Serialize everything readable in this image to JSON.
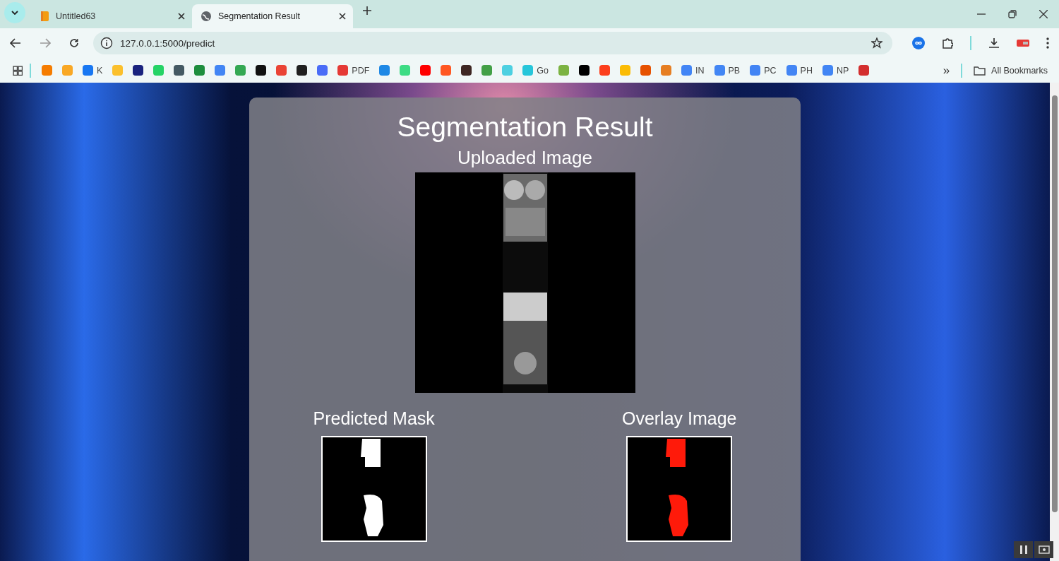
{
  "tabs": [
    {
      "title": "Untitled63",
      "selected": false
    },
    {
      "title": "Segmentation Result",
      "selected": true
    }
  ],
  "address_bar": {
    "url": "127.0.0.1:5000/predict"
  },
  "bookmarks": [
    {
      "color": "#f57c00"
    },
    {
      "color": "#f9a825"
    },
    {
      "color": "#1877f2",
      "label": "K"
    },
    {
      "color": "#fbc02d"
    },
    {
      "color": "#1a237e"
    },
    {
      "color": "#25d366"
    },
    {
      "color": "#455a64"
    },
    {
      "color": "#1e8e3e"
    },
    {
      "color": "#4285f4"
    },
    {
      "color": "#34a853"
    },
    {
      "color": "#111111"
    },
    {
      "color": "#ea4335"
    },
    {
      "color": "#202020"
    },
    {
      "color": "#4a6cf7"
    },
    {
      "color": "#e53935",
      "label": "PDF"
    },
    {
      "color": "#1e88e5"
    },
    {
      "color": "#3ddc84"
    },
    {
      "color": "#ff0000"
    },
    {
      "color": "#ff5722"
    },
    {
      "color": "#3e2723"
    },
    {
      "color": "#43a047"
    },
    {
      "color": "#4dd0e1"
    },
    {
      "color": "#26c6da",
      "label": "Go"
    },
    {
      "color": "#7cb342"
    },
    {
      "color": "#000000"
    },
    {
      "color": "#fc3f1d"
    },
    {
      "color": "#fbbc05"
    },
    {
      "color": "#e65100"
    },
    {
      "color": "#e67e22"
    },
    {
      "color": "#4285f5",
      "label": "IN"
    },
    {
      "color": "#4286f4",
      "label": "PB"
    },
    {
      "color": "#4284f4",
      "label": "PC"
    },
    {
      "color": "#4385f4",
      "label": "PH"
    },
    {
      "color": "#4185f4",
      "label": "NP"
    },
    {
      "color": "#d32f2f"
    }
  ],
  "bookmarks_more": "»",
  "all_bookmarks": "All Bookmarks",
  "page": {
    "title": "Segmentation Result",
    "uploaded_label": "Uploaded Image",
    "results": [
      {
        "label": "Predicted Mask",
        "kind": "mask"
      },
      {
        "label": "Overlay Image",
        "kind": "overlay"
      }
    ]
  }
}
